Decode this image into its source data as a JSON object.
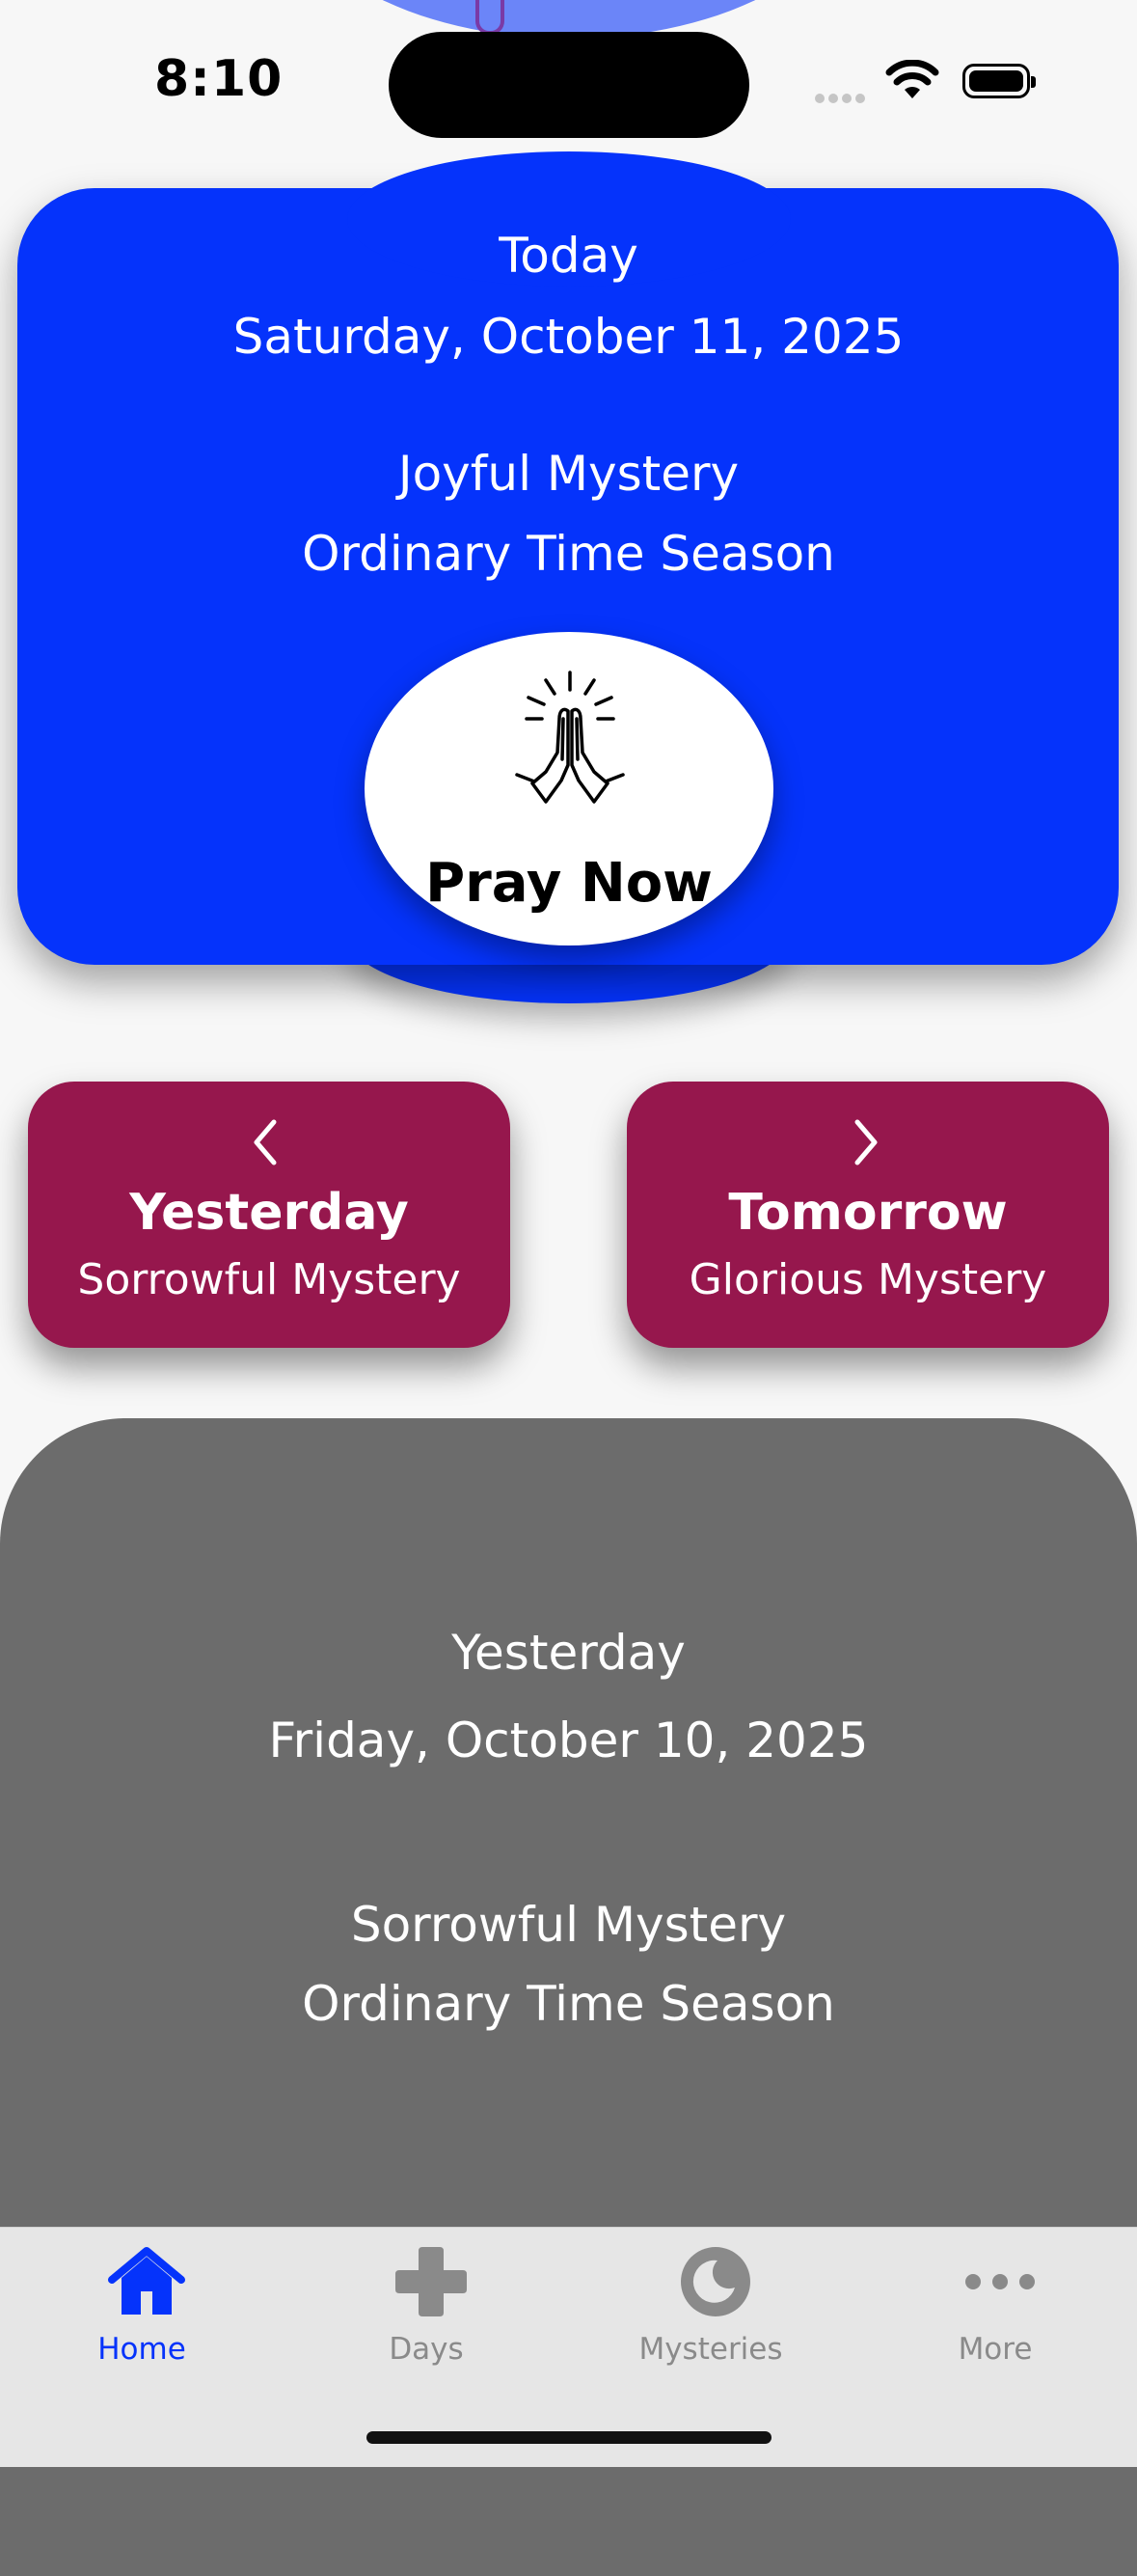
{
  "status_bar": {
    "time": "8:10"
  },
  "today": {
    "label": "Today",
    "date": "Saturday, October 11, 2025",
    "mystery": "Joyful Mystery",
    "season": "Ordinary Time Season",
    "pray_button": "Pray Now",
    "pray_icon": "praying-hands-icon"
  },
  "nav": {
    "previous": {
      "title": "Yesterday",
      "subtitle": "Sorrowful Mystery",
      "icon": "chevron-left-icon"
    },
    "next": {
      "title": "Tomorrow",
      "subtitle": "Glorious Mystery",
      "icon": "chevron-right-icon"
    }
  },
  "yesterday_panel": {
    "label": "Yesterday",
    "date": "Friday, October 10, 2025",
    "mystery": "Sorrowful Mystery",
    "season": "Ordinary Time Season"
  },
  "tabs": [
    {
      "label": "Home",
      "icon": "house-icon",
      "active": true
    },
    {
      "label": "Days",
      "icon": "cross-icon",
      "active": false
    },
    {
      "label": "Mysteries",
      "icon": "moon-icon",
      "active": false
    },
    {
      "label": "More",
      "icon": "ellipsis-icon",
      "active": false
    }
  ],
  "colors": {
    "today_card": "#0533fb",
    "nav_card": "#96174d",
    "yesterday_panel": "#6c6c6c",
    "tab_active": "#0533fb",
    "tab_inactive": "#8a8a8a"
  }
}
